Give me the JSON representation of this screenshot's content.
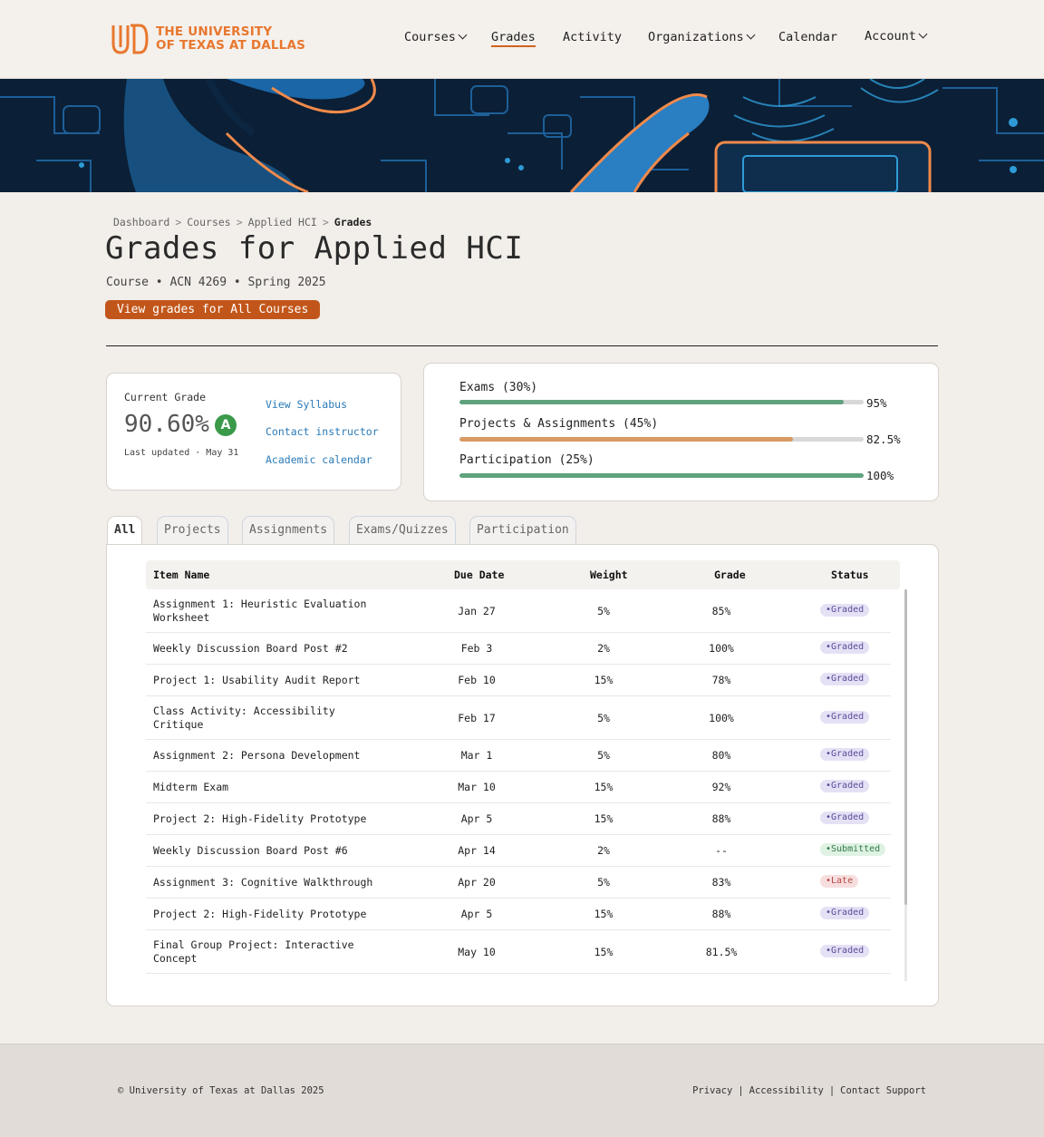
{
  "header": {
    "logo_line1": "THE UNIVERSITY",
    "logo_line2": "OF TEXAS AT DALLAS",
    "nav": {
      "courses": "Courses",
      "grades": "Grades",
      "activity": "Activity",
      "organizations": "Organizations",
      "calendar": "Calendar",
      "account": "Account"
    }
  },
  "breadcrumb": {
    "dashboard": "Dashboard",
    "courses": "Courses",
    "course": "Applied HCI",
    "current": "Grades",
    "separator": ">"
  },
  "page": {
    "title": "Grades for Applied HCI",
    "meta": "Course • ACN 4269 • Spring 2025",
    "all_courses_button": "View grades for All Courses"
  },
  "grade_card": {
    "label": "Current Grade",
    "value": "90.60%",
    "letter": "A",
    "updated": "Last updated · May 31",
    "links": {
      "syllabus": "View Syllabus",
      "instructor": "Contact instructor",
      "calendar": "Academic calendar"
    }
  },
  "breakdown": [
    {
      "label": "Exams (30%)",
      "value_text": "95%",
      "fraction": 0.95,
      "color": "#5fa37e"
    },
    {
      "label": "Projects & Assignments (45%)",
      "value_text": "82.5%",
      "fraction": 0.825,
      "color": "#d89a62"
    },
    {
      "label": "Participation (25%)",
      "value_text": "100%",
      "fraction": 1.0,
      "color": "#5fa37e"
    }
  ],
  "tabs": {
    "all": "All",
    "projects": "Projects",
    "assignments": "Assignments",
    "exams": "Exams/Quizzes",
    "participation": "Participation"
  },
  "table": {
    "columns": {
      "name": "Item Name",
      "due": "Due Date",
      "weight": "Weight",
      "grade": "Grade",
      "status": "Status"
    },
    "rows": [
      {
        "name": "Assignment 1: Heuristic Evaluation Worksheet",
        "due": "Jan 27",
        "weight": "5%",
        "grade": "85%",
        "status": "•Graded",
        "kind": "graded"
      },
      {
        "name": "Weekly Discussion Board Post #2",
        "due": "Feb 3",
        "weight": "2%",
        "grade": "100%",
        "status": "•Graded",
        "kind": "graded"
      },
      {
        "name": "Project 1: Usability Audit Report",
        "due": "Feb 10",
        "weight": "15%",
        "grade": "78%",
        "status": "•Graded",
        "kind": "graded"
      },
      {
        "name": "Class Activity: Accessibility Critique",
        "due": "Feb 17",
        "weight": "5%",
        "grade": "100%",
        "status": "•Graded",
        "kind": "graded"
      },
      {
        "name": "Assignment 2: Persona Development",
        "due": "Mar 1",
        "weight": "5%",
        "grade": "80%",
        "status": "•Graded",
        "kind": "graded"
      },
      {
        "name": "Midterm Exam",
        "due": "Mar 10",
        "weight": "15%",
        "grade": "92%",
        "status": "•Graded",
        "kind": "graded"
      },
      {
        "name": "Project 2: High-Fidelity Prototype",
        "due": "Apr 5",
        "weight": "15%",
        "grade": "88%",
        "status": "•Graded",
        "kind": "graded"
      },
      {
        "name": "Weekly Discussion Board Post #6",
        "due": "Apr 14",
        "weight": "2%",
        "grade": "--",
        "status": "•Submitted",
        "kind": "submitted"
      },
      {
        "name": "Assignment 3: Cognitive Walkthrough",
        "due": "Apr 20",
        "weight": "5%",
        "grade": "83%",
        "status": "•Late",
        "kind": "late"
      },
      {
        "name": "Project 2: High-Fidelity Prototype",
        "due": "Apr 5",
        "weight": "15%",
        "grade": "88%",
        "status": "•Graded",
        "kind": "graded"
      },
      {
        "name": "Final Group Project: Interactive Concept",
        "due": "May 10",
        "weight": "15%",
        "grade": "81.5%",
        "status": "•Graded",
        "kind": "graded"
      }
    ]
  },
  "footer": {
    "copyright": "© University of Texas at Dallas 2025",
    "privacy": "Privacy",
    "accessibility": "Accessibility",
    "contact": "Contact Support",
    "separator": "|"
  },
  "colors": {
    "accent": "#c2561a",
    "brand_orange": "#e8772e",
    "link": "#2a7ab8",
    "grade_badge": "#3a9a4a"
  },
  "icons": {
    "logo": "utd-logo-icon",
    "dropdown": "chevron-down-icon"
  }
}
